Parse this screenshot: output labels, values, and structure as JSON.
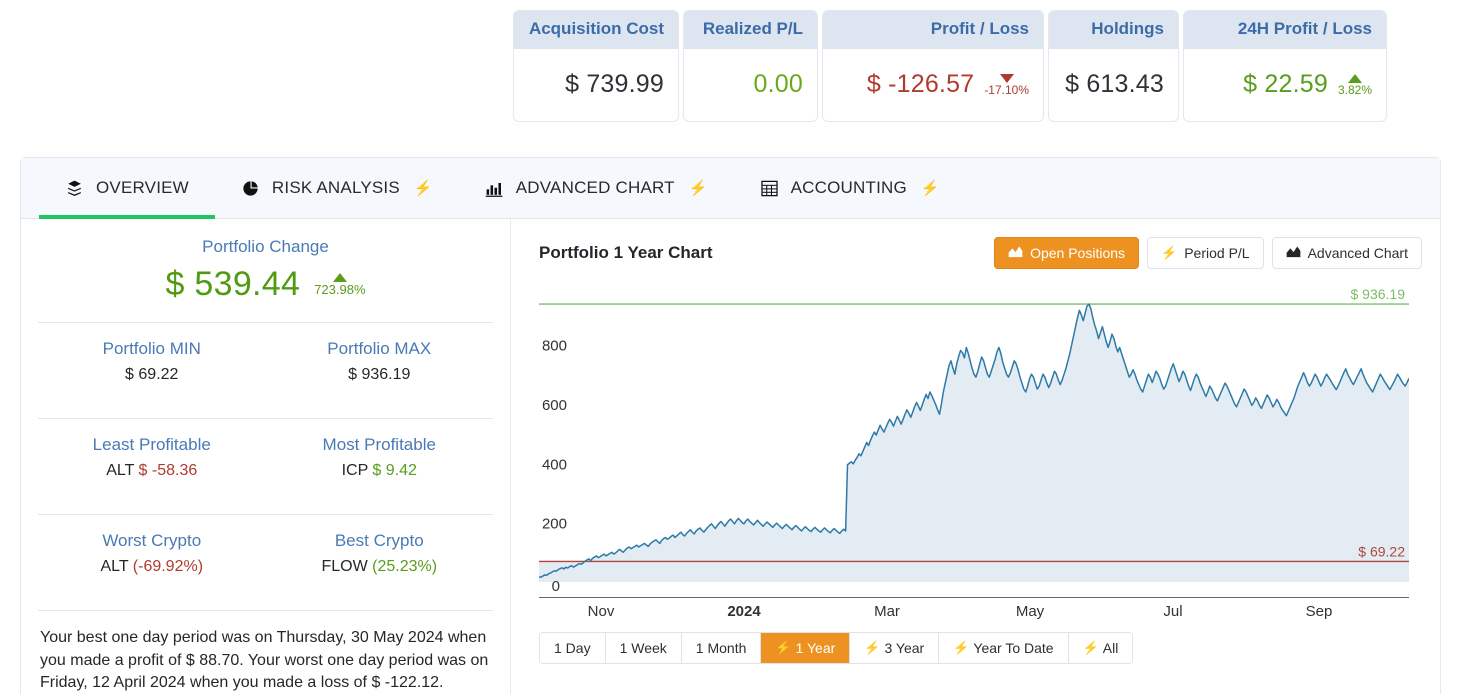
{
  "stats": [
    {
      "id": "acquisition-cost",
      "label": "Acquisition Cost",
      "value": "$ 739.99",
      "tone": "neutral",
      "delta": null,
      "delta_dir": null
    },
    {
      "id": "realized-pl",
      "label": "Realized P/L",
      "value": "0.00",
      "tone": "green",
      "delta": null,
      "delta_dir": null
    },
    {
      "id": "profit-loss",
      "label": "Profit / Loss",
      "value": "$ -126.57",
      "tone": "neg",
      "delta": "-17.10%",
      "delta_dir": "down"
    },
    {
      "id": "holdings",
      "label": "Holdings",
      "value": "$ 613.43",
      "tone": "neutral",
      "delta": null,
      "delta_dir": null
    },
    {
      "id": "24h-profit-loss",
      "label": "24H Profit / Loss",
      "value": "$ 22.59",
      "tone": "green",
      "delta": "3.82%",
      "delta_dir": "up"
    }
  ],
  "tabs": [
    {
      "label": "OVERVIEW",
      "icon": "layers-icon",
      "bolt": false,
      "active": true
    },
    {
      "label": "RISK ANALYSIS",
      "icon": "pie-chart-icon",
      "bolt": true,
      "active": false
    },
    {
      "label": "ADVANCED CHART",
      "icon": "bar-chart-icon",
      "bolt": true,
      "active": false
    },
    {
      "label": "ACCOUNTING",
      "icon": "table-grid-icon",
      "bolt": true,
      "active": false
    }
  ],
  "overview": {
    "portfolio_change_label": "Portfolio Change",
    "portfolio_change_value": "$ 539.44",
    "portfolio_change_pct": "723.98%",
    "portfolio_min_label": "Portfolio MIN",
    "portfolio_min_value": "$ 69.22",
    "portfolio_max_label": "Portfolio MAX",
    "portfolio_max_value": "$ 936.19",
    "least_profitable_label": "Least Profitable",
    "least_profitable_symbol": "ALT",
    "least_profitable_value": "$ -58.36",
    "most_profitable_label": "Most Profitable",
    "most_profitable_symbol": "ICP",
    "most_profitable_value": "$ 9.42",
    "worst_crypto_label": "Worst Crypto",
    "worst_crypto_symbol": "ALT",
    "worst_crypto_value": "(-69.92%)",
    "best_crypto_label": "Best Crypto",
    "best_crypto_symbol": "FLOW",
    "best_crypto_value": "(25.23%)",
    "summary": "Your best one day period was on Thursday, 30 May 2024 when you made a profit of $ 88.70. Your worst one day period was on Friday, 12 April 2024 when you made a loss of $ -122.12."
  },
  "chart_panel": {
    "title": "Portfolio 1 Year Chart",
    "buttons": [
      {
        "label": "Open Positions",
        "icon": "area-chart-icon",
        "active": true,
        "bolt": false
      },
      {
        "label": "Period P/L",
        "icon": null,
        "active": false,
        "bolt": true
      },
      {
        "label": "Advanced Chart",
        "icon": "area-chart-icon",
        "active": false,
        "bolt": false
      }
    ],
    "periods": [
      {
        "label": "1 Day",
        "bolt": false,
        "active": false
      },
      {
        "label": "1 Week",
        "bolt": false,
        "active": false
      },
      {
        "label": "1 Month",
        "bolt": false,
        "active": false
      },
      {
        "label": "1 Year",
        "bolt": true,
        "active": true
      },
      {
        "label": "3 Year",
        "bolt": true,
        "active": false
      },
      {
        "label": "Year To Date",
        "bolt": true,
        "active": false
      },
      {
        "label": "All",
        "bolt": true,
        "active": false
      }
    ]
  },
  "chart_data": {
    "type": "area",
    "title": "Portfolio 1 Year Chart",
    "xlabel": "",
    "ylabel": "",
    "ylim": [
      0,
      960
    ],
    "yticks": [
      0,
      200,
      400,
      600,
      800
    ],
    "ytick_labels": [
      "0",
      "200",
      "400",
      "600",
      "800"
    ],
    "xticks": [
      "Nov",
      "2024",
      "Mar",
      "May",
      "Jul",
      "Sep"
    ],
    "xtick_bold": [
      false,
      true,
      false,
      false,
      false,
      false
    ],
    "grid": false,
    "legend": "none",
    "line_color": "#2e7aa8",
    "fill_color": "#e3ebf3",
    "max_line": {
      "value": 936.19,
      "label": "$ 936.19",
      "color": "#7bbf6a"
    },
    "min_line": {
      "value": 69.22,
      "label": "$ 69.22",
      "color": "#b0463b"
    },
    "series": [
      {
        "name": "Portfolio Value",
        "values": [
          18,
          16,
          20,
          24,
          22,
          28,
          30,
          34,
          38,
          36,
          42,
          45,
          48,
          44,
          50,
          47,
          52,
          55,
          50,
          54,
          58,
          62,
          60,
          64,
          70,
          74,
          78,
          72,
          80,
          84,
          88,
          82,
          86,
          90,
          94,
          88,
          92,
          96,
          100,
          94,
          98,
          104,
          110,
          105,
          100,
          108,
          114,
          118,
          112,
          116,
          120,
          124,
          118,
          122,
          126,
          130,
          125,
          120,
          128,
          134,
          138,
          142,
          136,
          130,
          140,
          146,
          150,
          144,
          148,
          154,
          158,
          150,
          156,
          162,
          168,
          160,
          155,
          164,
          170,
          176,
          168,
          162,
          172,
          178,
          182,
          174,
          168,
          176,
          184,
          190,
          196,
          188,
          180,
          190,
          198,
          204,
          196,
          188,
          198,
          206,
          212,
          204,
          196,
          206,
          214,
          208,
          200,
          196,
          206,
          212,
          204,
          198,
          192,
          200,
          208,
          200,
          194,
          188,
          196,
          202,
          196,
          190,
          184,
          192,
          198,
          192,
          186,
          180,
          188,
          194,
          188,
          182,
          176,
          184,
          190,
          184,
          178,
          172,
          180,
          186,
          180,
          174,
          170,
          178,
          184,
          178,
          172,
          168,
          176,
          182,
          176,
          170,
          166,
          174,
          180,
          174,
          168,
          164,
          172,
          178,
          172,
          395,
          400,
          405,
          398,
          410,
          420,
          432,
          425,
          440,
          455,
          470,
          460,
          478,
          492,
          505,
          495,
          512,
          528,
          516,
          505,
          520,
          535,
          548,
          538,
          525,
          542,
          558,
          545,
          532,
          548,
          565,
          580,
          568,
          555,
          572,
          590,
          605,
          592,
          578,
          596,
          615,
          632,
          618,
          640,
          628,
          612,
          598,
          580,
          565,
          600,
          640,
          670,
          700,
          730,
          745,
          720,
          700,
          735,
          760,
          780,
          772,
          755,
          790,
          770,
          745,
          720,
          700,
          690,
          710,
          735,
          758,
          745,
          722,
          700,
          690,
          710,
          730,
          750,
          775,
          790,
          770,
          740,
          720,
          700,
          690,
          705,
          725,
          745,
          735,
          715,
          690,
          670,
          650,
          640,
          660,
          685,
          700,
          690,
          670,
          650,
          660,
          680,
          700,
          690,
          670,
          655,
          670,
          690,
          710,
          700,
          680,
          665,
          680,
          700,
          720,
          745,
          770,
          800,
          830,
          860,
          890,
          915,
          900,
          880,
          905,
          930,
          936,
          920,
          890,
          865,
          845,
          820,
          840,
          860,
          835,
          810,
          790,
          810,
          835,
          820,
          795,
          775,
          790,
          770,
          750,
          730,
          710,
          690,
          700,
          715,
          700,
          680,
          665,
          650,
          640,
          660,
          680,
          700,
          690,
          672,
          690,
          710,
          700,
          685,
          665,
          650,
          660,
          680,
          700,
          720,
          735,
          715,
          695,
          675,
          690,
          710,
          700,
          680,
          660,
          645,
          665,
          685,
          700,
          690,
          670,
          655,
          640,
          625,
          640,
          660,
          650,
          635,
          620,
          610,
          625,
          640,
          655,
          670,
          660,
          645,
          630,
          615,
          600,
          590,
          605,
          620,
          635,
          650,
          640,
          625,
          610,
          595,
          605,
          620,
          610,
          595,
          585,
          600,
          615,
          630,
          620,
          605,
          590,
          600,
          615,
          605,
          590,
          578,
          570,
          560,
          575,
          590,
          605,
          620,
          640,
          660,
          675,
          690,
          705,
          690,
          672,
          660,
          670,
          685,
          700,
          690,
          675,
          660,
          672,
          688,
          700,
          690,
          680,
          668,
          658,
          648,
          660,
          675,
          690,
          705,
          718,
          700,
          688,
          675,
          665,
          678,
          692,
          705,
          718,
          700,
          685,
          670,
          660,
          650,
          640,
          655,
          670,
          685,
          700,
          690,
          678,
          668,
          658,
          648,
          660,
          672,
          685,
          700,
          690,
          678,
          668,
          660,
          672,
          686
        ]
      }
    ]
  }
}
